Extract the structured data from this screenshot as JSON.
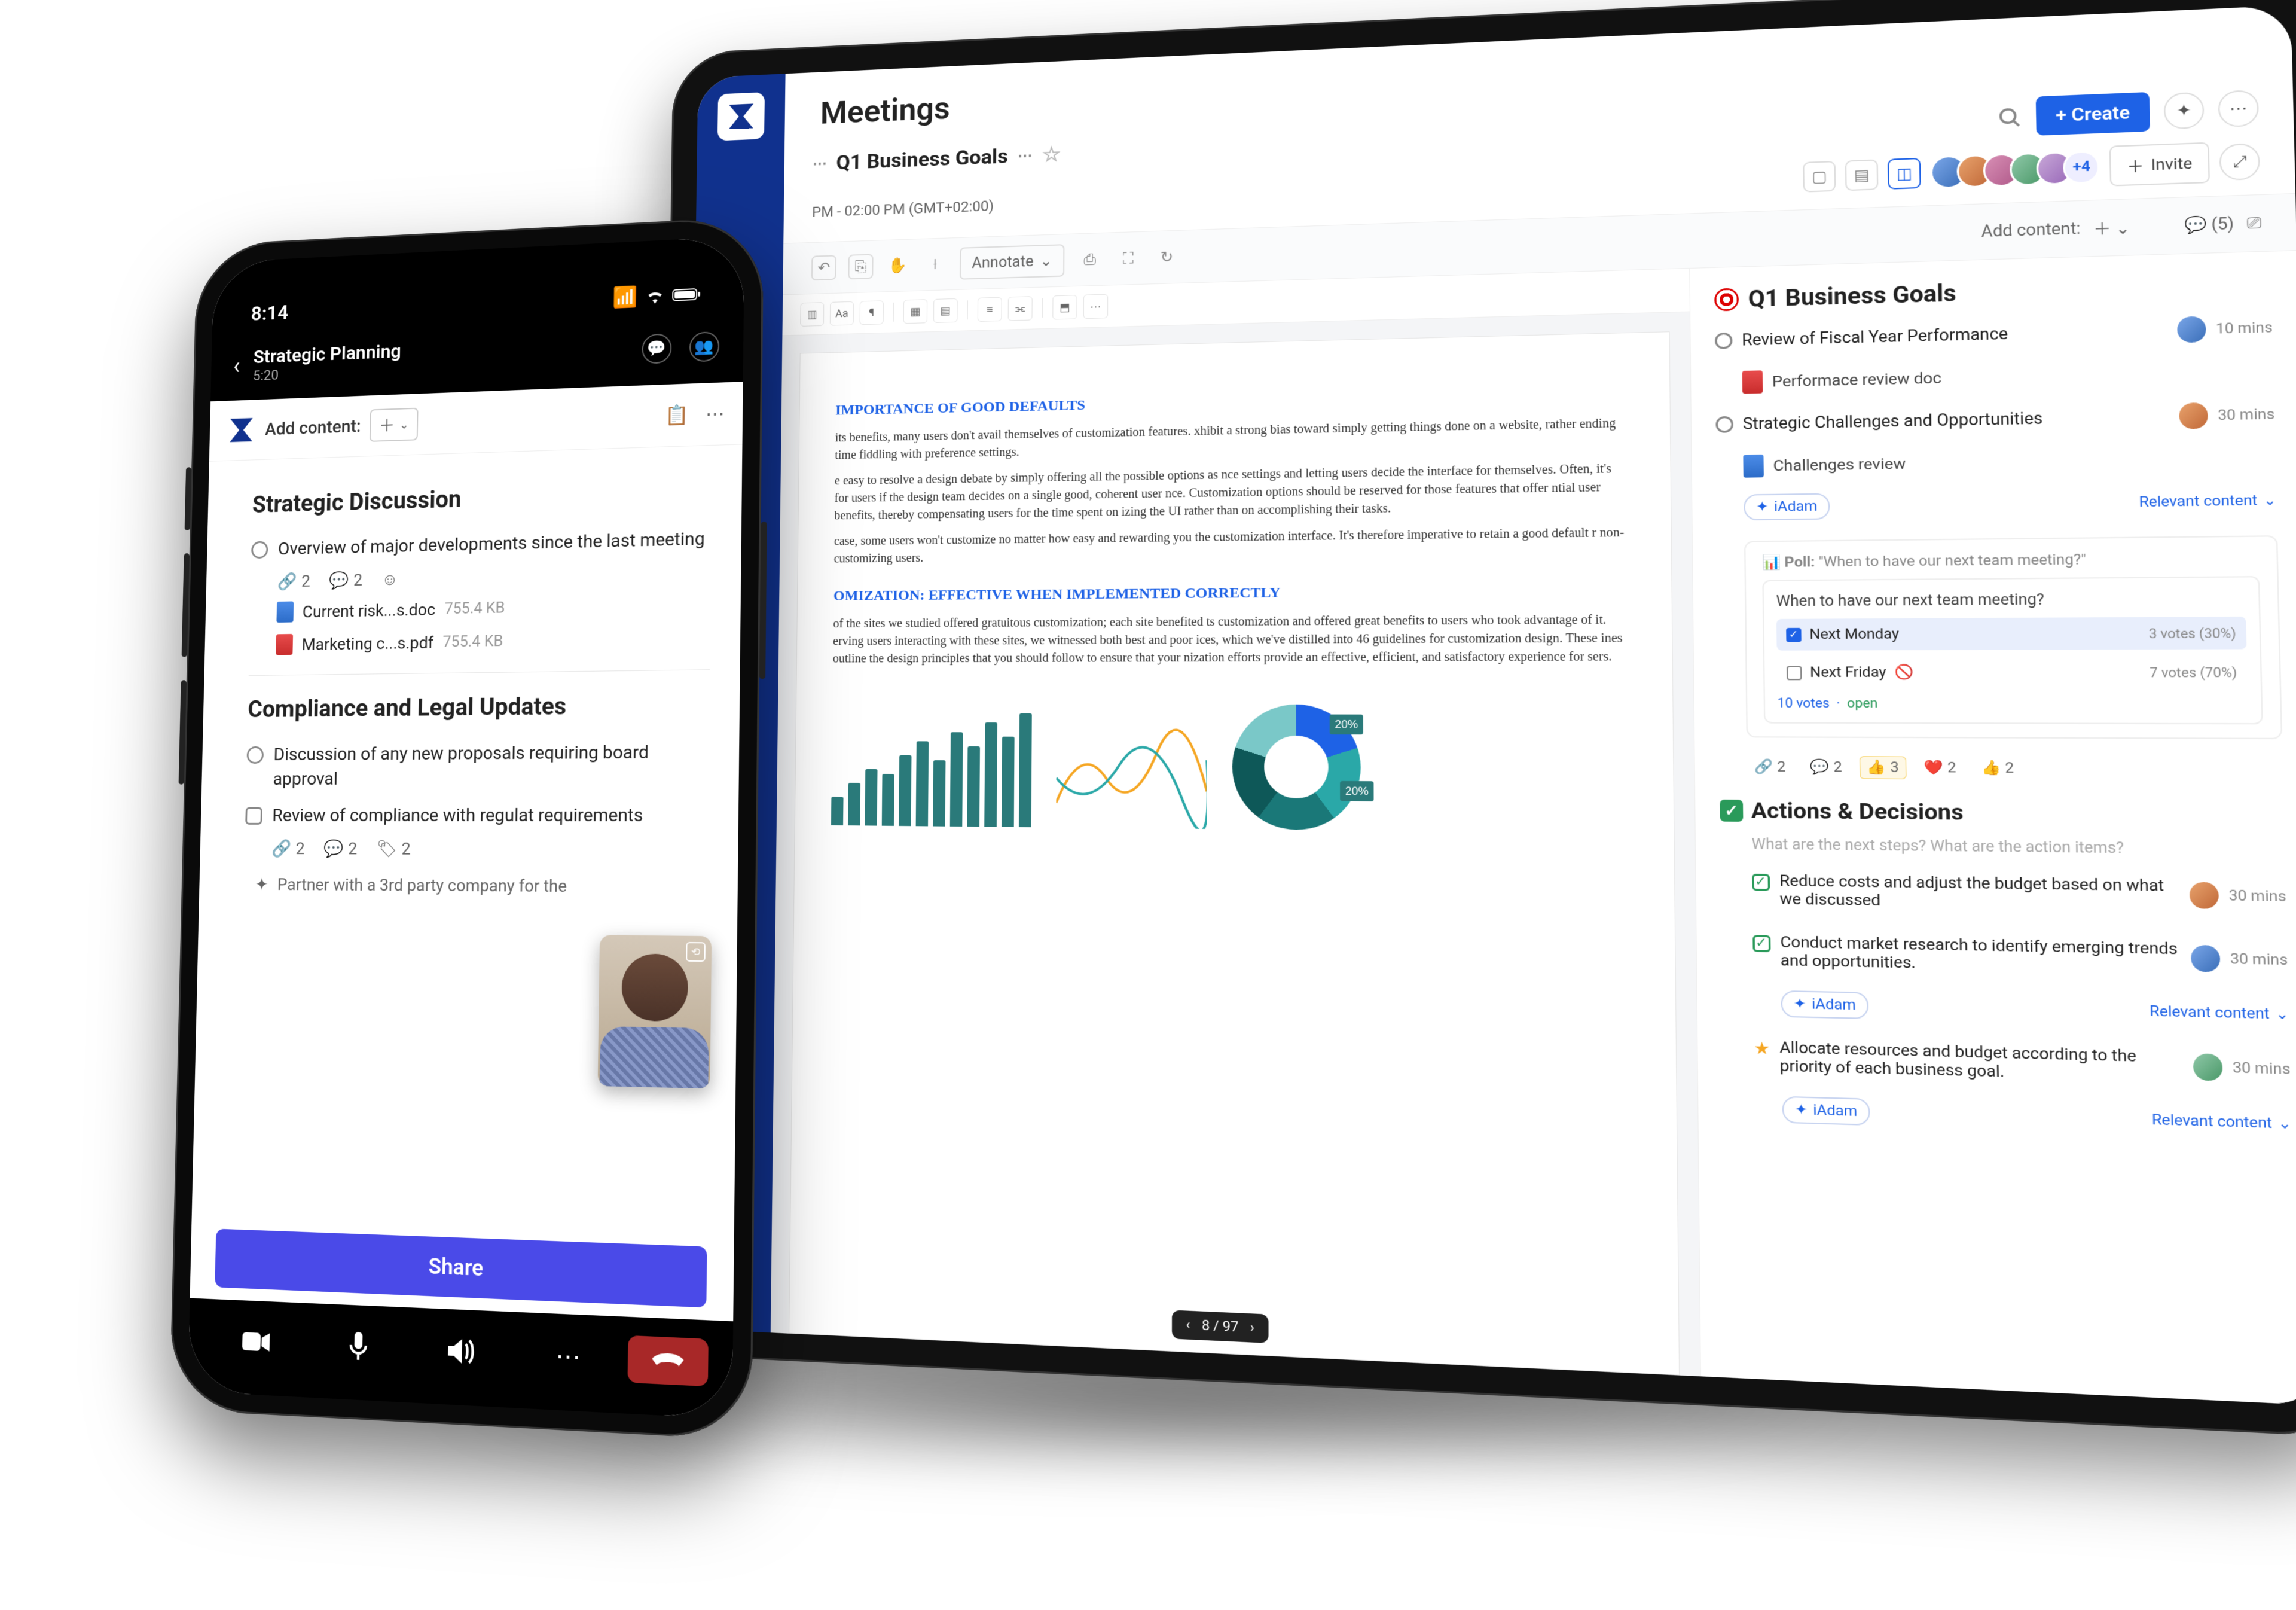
{
  "tablet": {
    "section": "Meetings",
    "page_title": "Q1 Business Goals",
    "timezone": "PM - 02:00 PM (GMT+02:00)",
    "create": "+ Create",
    "invite": "Invite",
    "avatar_more": "+4",
    "toolbar": {
      "annotate": "Annotate",
      "add_content": "Add content:",
      "comment_count": "(5)"
    },
    "doc": {
      "h1": "IMPORTANCE OF GOOD DEFAULTS",
      "p1": "its benefits, many users don't avail themselves of customization features. xhibit a strong bias toward simply getting things done on a website, rather ending time fiddling with preference settings.",
      "p2": "e easy to resolve a design debate by simply offering all the possible options as nce settings and letting users decide the interface for themselves. Often, it's for users if the design team decides on a single good, coherent user nce. Customization options should be reserved for those features that offer ntial user benefits, thereby compensating users for the time spent on izing the UI rather than on accomplishing their tasks.",
      "p3": "case, some users won't customize no matter how easy and rewarding you the customization interface. It's therefore imperative to retain a good default r non-customizing users.",
      "h2": "OMIZATION: EFFECTIVE WHEN IMPLEMENTED CORRECTLY",
      "p4": "of the sites we studied offered gratuitous customization; each site benefited ts customization and offered great benefits to users who took advantage of it. erving users interacting with these sites, we witnessed both best and poor ices, which we've distilled into 46 guidelines for customization design. These ines outline the design principles that you should follow to ensure that your nization efforts provide an effective, efficient, and satisfactory experience for sers.",
      "donut1": "20%",
      "donut2": "20%",
      "pager": "8 / 97"
    },
    "side": {
      "title": "Q1 Business Goals",
      "a1": "Review of Fiscal Year Performance",
      "a1_mins": "10 mins",
      "a1_file": "Performace review doc",
      "a2": "Strategic Challenges and Opportunities",
      "a2_mins": "30 mins",
      "a2_file": "Challenges review",
      "ai_name": "iAdam",
      "relevant": "Relevant content",
      "poll_label": "Poll:",
      "poll_quote": "\"When to have our next team meeting?\"",
      "poll_q": "When to have our next team meeting?",
      "opt1": "Next Monday",
      "opt1_meta": "3 votes (30%)",
      "opt2": "Next Friday",
      "opt2_meta": "7 votes (70%)",
      "votes": "10 votes",
      "open": "open",
      "r_link": "2",
      "r_comment": "2",
      "r_thumbs": "3",
      "r_heart": "2",
      "r_like": "2",
      "actions_title": "Actions & Decisions",
      "actions_sub": "What are the next steps? What are the action items?",
      "act1": "Reduce costs and adjust the budget based on what we discussed",
      "act1_mins": "30 mins",
      "act2": "Conduct market research to identify emerging trends and opportunities.",
      "act2_mins": "30 mins",
      "act3": "Allocate resources and budget according to the priority of each business goal.",
      "act3_mins": "30 mins"
    }
  },
  "phone": {
    "time": "8:14",
    "title": "Strategic Planning",
    "duration": "5:20",
    "add_content": "Add content:",
    "h1": "Strategic Discussion",
    "item1": "Overview of major developments since the last meeting",
    "link_n": "2",
    "comment_n": "2",
    "file1": "Current risk...s.doc",
    "file1_size": "755.4 KB",
    "file2": "Marketing c...s.pdf",
    "file2_size": "755.4 KB",
    "h2": "Compliance and Legal Updates",
    "item2": "Discussion of any new proposals requiring board approval",
    "item3": "Review of compliance with regulat requirements",
    "link_n2": "2",
    "comment_n2": "2",
    "tag_n2": "2",
    "partner": "Partner with a 3rd party company for the",
    "share": "Share"
  },
  "chart_data": {
    "type": "bar",
    "values": [
      30,
      45,
      60,
      55,
      75,
      90,
      70,
      100,
      85,
      110,
      95,
      120
    ],
    "ylim": [
      0,
      130
    ]
  }
}
